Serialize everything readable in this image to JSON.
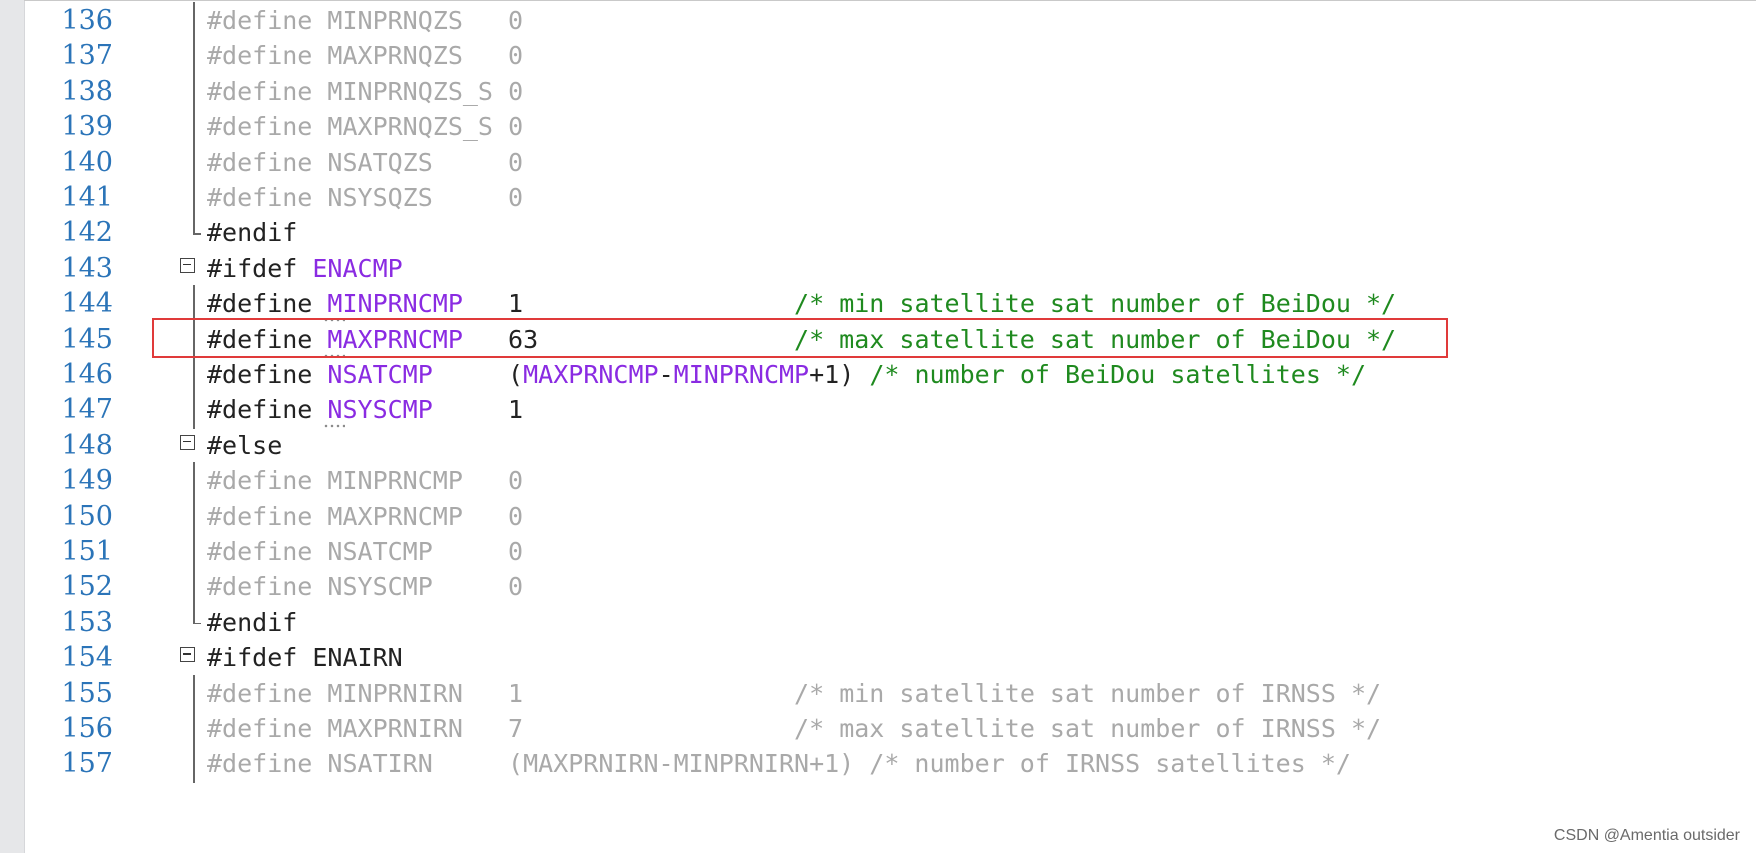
{
  "lines": [
    {
      "n": "136",
      "tokens": [
        [
          "#define ",
          "kw"
        ],
        [
          "MINPRNQZS",
          "m"
        ],
        [
          "   ",
          "v"
        ],
        [
          "0",
          "v"
        ]
      ],
      "inactive": true,
      "gutter": "line"
    },
    {
      "n": "137",
      "tokens": [
        [
          "#define ",
          "kw"
        ],
        [
          "MAXPRNQZS",
          "m"
        ],
        [
          "   ",
          "v"
        ],
        [
          "0",
          "v"
        ]
      ],
      "inactive": true,
      "gutter": "line"
    },
    {
      "n": "138",
      "tokens": [
        [
          "#define ",
          "kw"
        ],
        [
          "MINPRNQZS_S",
          "m"
        ],
        [
          " ",
          "v"
        ],
        [
          "0",
          "v"
        ]
      ],
      "inactive": true,
      "gutter": "line"
    },
    {
      "n": "139",
      "tokens": [
        [
          "#define ",
          "kw"
        ],
        [
          "MAXPRNQZS_S",
          "m"
        ],
        [
          " ",
          "v"
        ],
        [
          "0",
          "v"
        ]
      ],
      "inactive": true,
      "gutter": "line"
    },
    {
      "n": "140",
      "tokens": [
        [
          "#define ",
          "kw"
        ],
        [
          "NSATQZS",
          "m"
        ],
        [
          "     ",
          "v"
        ],
        [
          "0",
          "v"
        ]
      ],
      "inactive": true,
      "gutter": "line"
    },
    {
      "n": "141",
      "tokens": [
        [
          "#define ",
          "kw"
        ],
        [
          "NSYSQZS",
          "m"
        ],
        [
          "     ",
          "v"
        ],
        [
          "0",
          "v"
        ]
      ],
      "inactive": true,
      "gutter": "line"
    },
    {
      "n": "142",
      "tokens": [
        [
          "#endif",
          "kw"
        ]
      ],
      "inactive": false,
      "gutter": "end"
    },
    {
      "n": "143",
      "tokens": [
        [
          "#ifdef ",
          "kw"
        ],
        [
          "ENACMP",
          "m"
        ]
      ],
      "inactive": false,
      "gutter": "fold"
    },
    {
      "n": "144",
      "tokens": [
        [
          "#define ",
          "kw"
        ],
        [
          "MINPRNCMP",
          "m"
        ],
        [
          "   ",
          "v"
        ],
        [
          "1",
          "v"
        ],
        [
          "                  ",
          "v"
        ],
        [
          "/* min satellite sat number of BeiDou */",
          "c"
        ]
      ],
      "inactive": false,
      "gutter": "line",
      "dots": true
    },
    {
      "n": "145",
      "tokens": [
        [
          "#define ",
          "kw"
        ],
        [
          "MAXPRNCMP",
          "m"
        ],
        [
          "   ",
          "v"
        ],
        [
          "63",
          "v"
        ],
        [
          "                 ",
          "v"
        ],
        [
          "/* max satellite sat number of BeiDou */",
          "c"
        ]
      ],
      "inactive": false,
      "gutter": "line",
      "dots": true
    },
    {
      "n": "146",
      "tokens": [
        [
          "#define ",
          "kw"
        ],
        [
          "NSATCMP",
          "m"
        ],
        [
          "     ",
          "v"
        ],
        [
          "(",
          "v"
        ],
        [
          "MAXPRNCMP",
          "m"
        ],
        [
          "-",
          "v"
        ],
        [
          "MINPRNCMP",
          "m"
        ],
        [
          "+1) ",
          "v"
        ],
        [
          "/* number of BeiDou satellites */",
          "c"
        ]
      ],
      "inactive": false,
      "gutter": "line"
    },
    {
      "n": "147",
      "tokens": [
        [
          "#define ",
          "kw"
        ],
        [
          "NSYSCMP",
          "m"
        ],
        [
          "     ",
          "v"
        ],
        [
          "1",
          "v"
        ]
      ],
      "inactive": false,
      "gutter": "line",
      "dots": true
    },
    {
      "n": "148",
      "tokens": [
        [
          "#else",
          "kw"
        ]
      ],
      "inactive": false,
      "gutter": "fold"
    },
    {
      "n": "149",
      "tokens": [
        [
          "#define ",
          "kw"
        ],
        [
          "MINPRNCMP",
          "m"
        ],
        [
          "   ",
          "v"
        ],
        [
          "0",
          "v"
        ]
      ],
      "inactive": true,
      "gutter": "line"
    },
    {
      "n": "150",
      "tokens": [
        [
          "#define ",
          "kw"
        ],
        [
          "MAXPRNCMP",
          "m"
        ],
        [
          "   ",
          "v"
        ],
        [
          "0",
          "v"
        ]
      ],
      "inactive": true,
      "gutter": "line"
    },
    {
      "n": "151",
      "tokens": [
        [
          "#define ",
          "kw"
        ],
        [
          "NSATCMP",
          "m"
        ],
        [
          "     ",
          "v"
        ],
        [
          "0",
          "v"
        ]
      ],
      "inactive": true,
      "gutter": "line"
    },
    {
      "n": "152",
      "tokens": [
        [
          "#define ",
          "kw"
        ],
        [
          "NSYSCMP",
          "m"
        ],
        [
          "     ",
          "v"
        ],
        [
          "0",
          "v"
        ]
      ],
      "inactive": true,
      "gutter": "line"
    },
    {
      "n": "153",
      "tokens": [
        [
          "#endif",
          "kw"
        ]
      ],
      "inactive": false,
      "gutter": "end"
    },
    {
      "n": "154",
      "tokens": [
        [
          "#ifdef ",
          "kw"
        ],
        [
          "ENAIRN",
          "v"
        ]
      ],
      "inactive": false,
      "gutter": "fold"
    },
    {
      "n": "155",
      "tokens": [
        [
          "#define ",
          "kw"
        ],
        [
          "MINPRNIRN",
          "m"
        ],
        [
          "   ",
          "v"
        ],
        [
          "1",
          "v"
        ],
        [
          "                  ",
          "v"
        ],
        [
          "/* min satellite sat number of IRNSS */",
          "c"
        ]
      ],
      "inactive": true,
      "gutter": "line"
    },
    {
      "n": "156",
      "tokens": [
        [
          "#define ",
          "kw"
        ],
        [
          "MAXPRNIRN",
          "m"
        ],
        [
          "   ",
          "v"
        ],
        [
          "7",
          "v"
        ],
        [
          "                  ",
          "v"
        ],
        [
          "/* max satellite sat number of IRNSS */",
          "c"
        ]
      ],
      "inactive": true,
      "gutter": "line"
    },
    {
      "n": "157",
      "tokens": [
        [
          "#define ",
          "kw"
        ],
        [
          "NSATIRN",
          "m"
        ],
        [
          "     ",
          "v"
        ],
        [
          "(MAXPRNIRN-MINPRNIRN+1) ",
          "v"
        ],
        [
          "/* number of IRNSS satellites */",
          "c"
        ]
      ],
      "inactive": true,
      "gutter": "line"
    }
  ],
  "highlighted_line": "145",
  "watermark": "CSDN @Amentia outsider",
  "colors": {
    "line_number": "#2b74b8",
    "macro": "#8a2be2",
    "comment": "#1f8a1f",
    "inactive": "#a9a9a9",
    "highlight_box": "#e03a3a"
  }
}
